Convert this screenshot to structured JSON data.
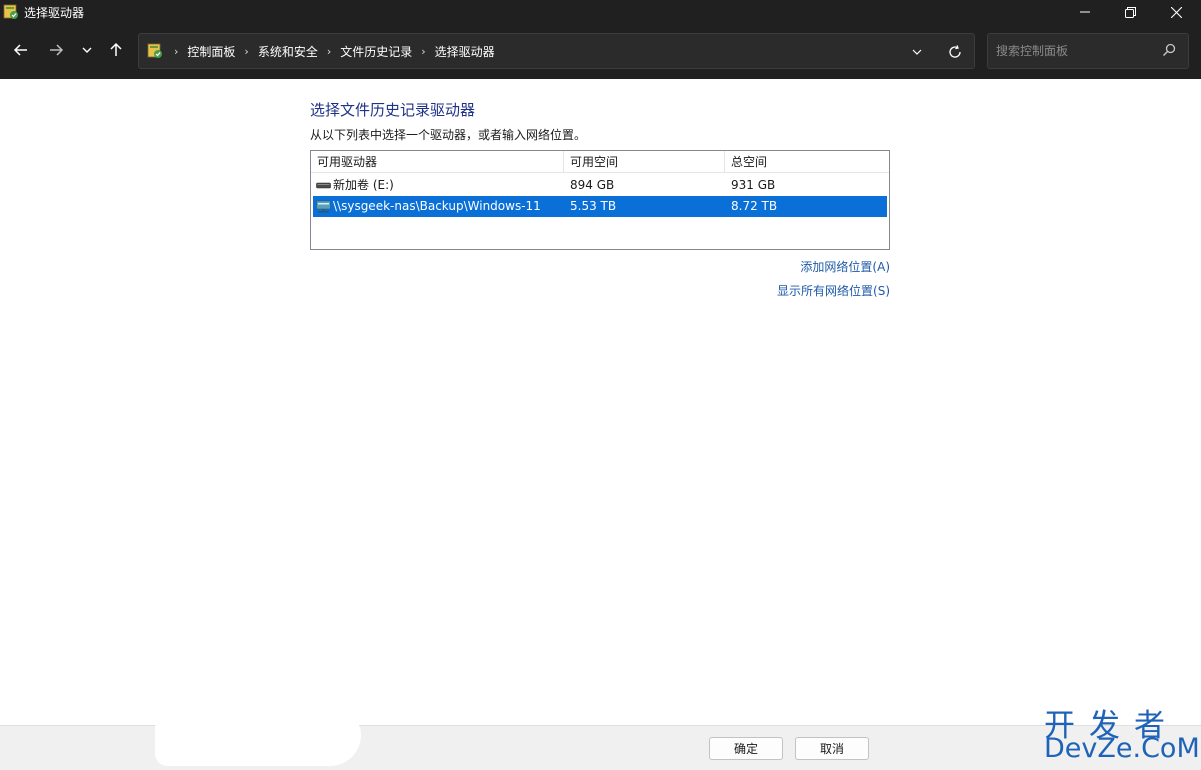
{
  "window": {
    "title": "选择驱动器",
    "controls": [
      "minimize-icon",
      "restore-icon",
      "close-icon"
    ]
  },
  "nav": {
    "breadcrumbs": [
      "控制面板",
      "系统和安全",
      "文件历史记录",
      "选择驱动器"
    ],
    "search_placeholder": "搜索控制面板"
  },
  "content": {
    "title": "选择文件历史记录驱动器",
    "description": "从以下列表中选择一个驱动器，或者输入网络位置。",
    "table": {
      "columns": [
        "可用驱动器",
        "可用空间",
        "总空间"
      ],
      "rows": [
        {
          "name": "新加卷 (E:)",
          "free": "894 GB",
          "total": "931 GB",
          "icon": "drive-icon",
          "selected": false
        },
        {
          "name": "\\\\sysgeek-nas\\Backup\\Windows-11",
          "free": "5.53 TB",
          "total": "8.72 TB",
          "icon": "network-drive-icon",
          "selected": true
        }
      ]
    },
    "links": {
      "add_network": "添加网络位置(A)",
      "show_all_network": "显示所有网络位置(S)"
    }
  },
  "footer": {
    "ok_label": "确定",
    "cancel_label": "取消"
  },
  "watermark": {
    "line1": "开发者",
    "line2": "DevZe.CoM"
  },
  "colors": {
    "titlebar_bg": "#202020",
    "selection": "#0a6fd6",
    "heading": "#1e3287",
    "link": "#1e5aa8"
  }
}
